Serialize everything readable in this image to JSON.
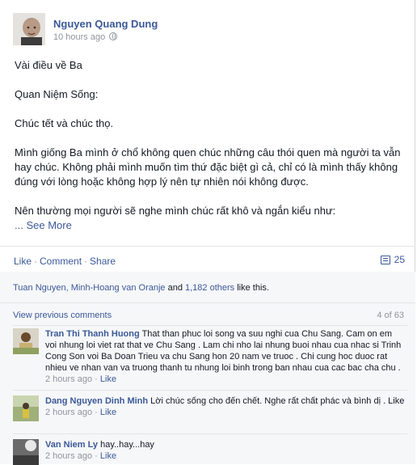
{
  "post": {
    "author": "Nguyen Quang Dung",
    "timestamp": "10 hours ago",
    "paragraphs": [
      "Vài điều về Ba",
      "Quan Niệm Sống:",
      "Chúc tết và chúc thọ.",
      "Mình giống Ba mình ở chổ không quen chúc những câu thói quen mà người ta vẫn hay chúc. Không phải mình muốn tìm thứ đặc biệt gì cả, chỉ có là mình thấy không đúng với lòng hoặc không hợp lý nên tự nhiên nói không được.",
      "Nên thường mọi người sẽ nghe mình chúc rất khô và ngắn kiểu như:"
    ],
    "see_more": "... See More"
  },
  "actions": {
    "like": "Like",
    "comment": "Comment",
    "share": "Share",
    "comment_count": "25"
  },
  "likes": {
    "names": "Tuan Nguyen, Minh-Hoang van Oranje",
    "and": " and ",
    "others": "1,182 others",
    "suffix": " like this."
  },
  "comments_header": {
    "view_previous": "View previous comments",
    "count": "4 of 63"
  },
  "comments": [
    {
      "name": "Tran Thi Thanh Huong",
      "text": "That than phuc loi song va suu nghi cua Chu Sang. Cam on em voi nhung loi viet rat that ve Chu Sang . Lam chi nho lai nhung buoi nhau cua nhac si Trinh Cong Son voi Ba Doan Trieu va chu Sang hon 20 nam ve truoc . Chi cung hoc duoc rat nhieu ve nhan van va truong thanh tu nhung loi binh trong ban nhau cua cac bac cha chu .",
      "time": "2 hours ago",
      "like": "Like"
    },
    {
      "name": "Dang Nguyen Dinh Minh",
      "text": "Lời chúc sống cho đến chết. Nghe rất chất phác và bình dị . Like",
      "time": "2 hours ago",
      "like": "Like"
    },
    {
      "name": "Van Niem Ly",
      "text": "hay..hay...hay",
      "time": "2 hours ago",
      "like": "Like"
    }
  ],
  "colors": {
    "link": "#3b5998",
    "muted": "#90949c",
    "feedback_bg": "#f6f7f9"
  }
}
